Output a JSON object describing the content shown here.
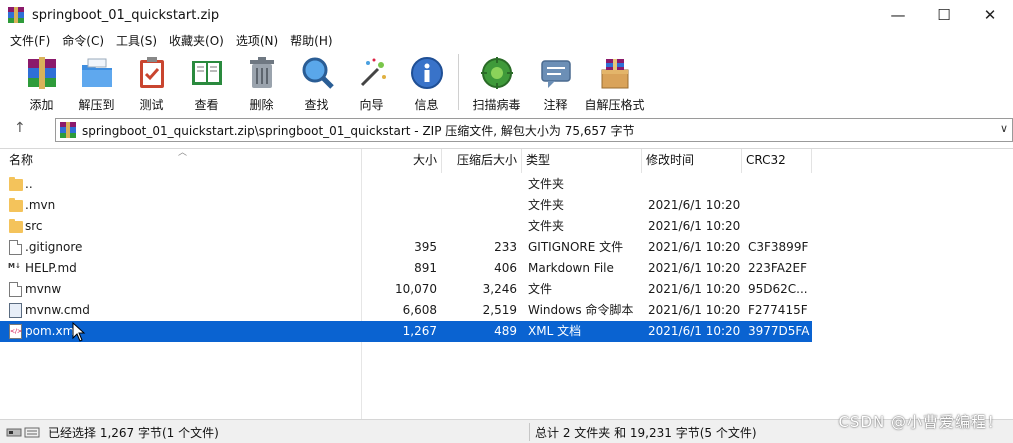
{
  "window": {
    "title": "springboot_01_quickstart.zip",
    "controls": [
      "—",
      "☐",
      "✕"
    ]
  },
  "menu": [
    "文件(F)",
    "命令(C)",
    "工具(S)",
    "收藏夹(O)",
    "选项(N)",
    "帮助(H)"
  ],
  "toolbar": [
    {
      "label": "添加",
      "icon": "rar-add-icon"
    },
    {
      "label": "解压到",
      "icon": "folder-extract-icon"
    },
    {
      "label": "测试",
      "icon": "clipboard-test-icon"
    },
    {
      "label": "查看",
      "icon": "book-view-icon"
    },
    {
      "label": "删除",
      "icon": "trash-icon"
    },
    {
      "label": "查找",
      "icon": "magnifier-icon"
    },
    {
      "label": "向导",
      "icon": "wand-icon"
    },
    {
      "label": "信息",
      "icon": "info-icon"
    },
    {
      "label": "扫描病毒",
      "icon": "virus-scan-icon"
    },
    {
      "label": "注释",
      "icon": "comment-icon"
    },
    {
      "label": "自解压格式",
      "icon": "sfx-box-icon"
    }
  ],
  "address": {
    "path": "springboot_01_quickstart.zip\\springboot_01_quickstart - ZIP 压缩文件, 解包大小为 75,657 字节"
  },
  "columns": {
    "name": "名称",
    "size": "大小",
    "packed": "压缩后大小",
    "type": "类型",
    "modified": "修改时间",
    "crc": "CRC32"
  },
  "files": [
    {
      "name": "..",
      "size": "",
      "packed": "",
      "type": "文件夹",
      "modified": "",
      "crc": "",
      "icon": "folder"
    },
    {
      "name": ".mvn",
      "size": "",
      "packed": "",
      "type": "文件夹",
      "modified": "2021/6/1 10:20",
      "crc": "",
      "icon": "folder"
    },
    {
      "name": "src",
      "size": "",
      "packed": "",
      "type": "文件夹",
      "modified": "2021/6/1 10:20",
      "crc": "",
      "icon": "folder"
    },
    {
      "name": ".gitignore",
      "size": "395",
      "packed": "233",
      "type": "GITIGNORE 文件",
      "modified": "2021/6/1 10:20",
      "crc": "C3F3899F",
      "icon": "doc"
    },
    {
      "name": "HELP.md",
      "size": "891",
      "packed": "406",
      "type": "Markdown File",
      "modified": "2021/6/1 10:20",
      "crc": "223FA2EF",
      "icon": "md"
    },
    {
      "name": "mvnw",
      "size": "10,070",
      "packed": "3,246",
      "type": "文件",
      "modified": "2021/6/1 10:20",
      "crc": "95D62C...",
      "icon": "doc"
    },
    {
      "name": "mvnw.cmd",
      "size": "6,608",
      "packed": "2,519",
      "type": "Windows 命令脚本",
      "modified": "2021/6/1 10:20",
      "crc": "F277415F",
      "icon": "cmd"
    },
    {
      "name": "pom.xml",
      "size": "1,267",
      "packed": "489",
      "type": "XML 文档",
      "modified": "2021/6/1 10:20",
      "crc": "3977D5FA",
      "icon": "xml",
      "selected": true
    }
  ],
  "status": {
    "left": "已经选择 1,267 字节(1 个文件)",
    "right": "总计 2 文件夹 和 19,231 字节(5 个文件)"
  },
  "watermark": "CSDN @小曹爱编程！"
}
